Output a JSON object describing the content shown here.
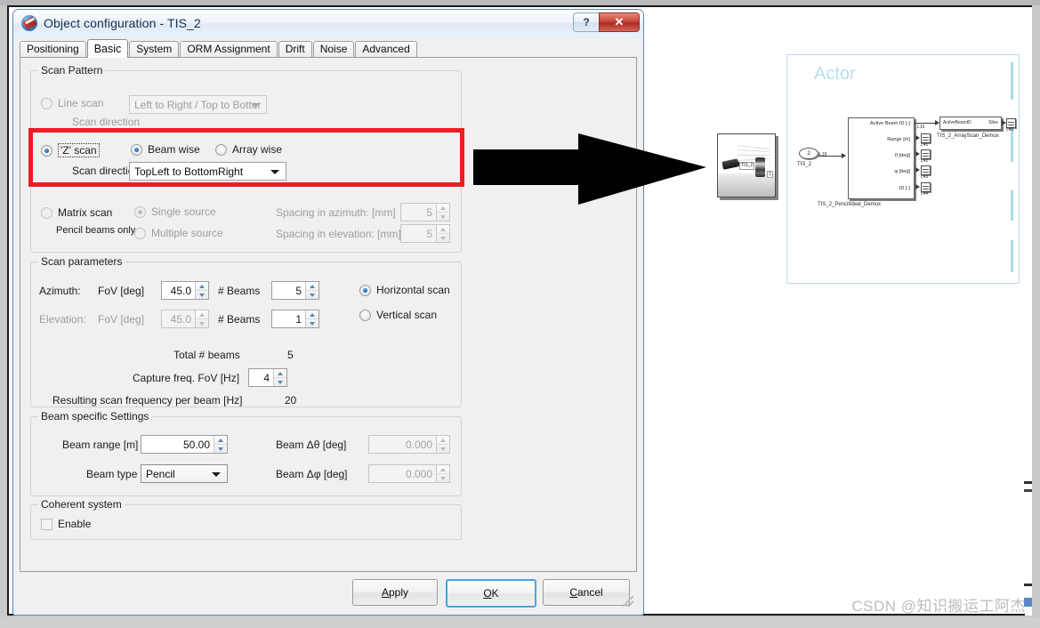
{
  "window": {
    "title": "Object configuration - TIS_2",
    "help_button": "?",
    "close_button": "✕",
    "app_icon": "globe-tool-icon"
  },
  "tabs": [
    {
      "label": "Positioning",
      "active": false
    },
    {
      "label": "Basic",
      "active": true
    },
    {
      "label": "System",
      "active": false
    },
    {
      "label": "ORM Assignment",
      "active": false
    },
    {
      "label": "Drift",
      "active": false
    },
    {
      "label": "Noise",
      "active": false
    },
    {
      "label": "Advanced",
      "active": false
    }
  ],
  "scan_pattern": {
    "legend": "Scan Pattern",
    "line_scan": {
      "label": "Line scan",
      "selected": false,
      "direction_label": "Scan direction",
      "direction_value": "Left to Right / Top to Bottor",
      "direction_enabled": false
    },
    "z_scan": {
      "label": "'Z' scan",
      "selected": true,
      "beam_wise": {
        "label": "Beam wise",
        "selected": true
      },
      "array_wise": {
        "label": "Array wise",
        "selected": false
      },
      "direction_label": "Scan direction",
      "direction_value": "TopLeft to BottomRight",
      "direction_enabled": true,
      "highlight_color": "#ee1c26"
    },
    "matrix_scan": {
      "label": "Matrix scan",
      "sublabel": "Pencil beams only",
      "selected": false,
      "single_source": {
        "label": "Single source",
        "selected": true
      },
      "multiple_source": {
        "label": "Multiple source",
        "selected": false
      },
      "spacing_azimuth_label": "Spacing in azimuth:   [mm]",
      "spacing_azimuth_value": "5",
      "spacing_elevation_label": "Spacing in elevation: [mm]",
      "spacing_elevation_value": "5"
    }
  },
  "scan_parameters": {
    "legend": "Scan parameters",
    "azimuth_label": "Azimuth:",
    "azimuth_fov_label": "FoV [deg]",
    "azimuth_fov_value": "45.0",
    "azimuth_beams_label": "# Beams",
    "azimuth_beams_value": "5",
    "elevation_label": "Elevation:",
    "elevation_fov_label": "FoV [deg]",
    "elevation_fov_value": "45.0",
    "elevation_beams_label": "# Beams",
    "elevation_beams_value": "1",
    "horizontal_scan": {
      "label": "Horizontal scan",
      "selected": true
    },
    "vertical_scan": {
      "label": "Vertical scan",
      "selected": false
    },
    "total_beams_label": "Total # beams",
    "total_beams_value": "5",
    "capture_freq_label": "Capture freq. FoV [Hz]",
    "capture_freq_value": "4",
    "resulting_freq_label": "Resulting scan frequency per beam [Hz]",
    "resulting_freq_value": "20"
  },
  "beam_settings": {
    "legend": "Beam specific Settings",
    "beam_range_label": "Beam range [m]",
    "beam_range_value": "50.00",
    "beam_type_label": "Beam type",
    "beam_type_value": "Pencil",
    "delta_theta_label": "Beam  Δθ [deg]",
    "delta_theta_value": "0.000",
    "delta_phi_label": "Beam  Δφ [deg]",
    "delta_phi_value": "0.000"
  },
  "coherent_system": {
    "legend": "Coherent system",
    "enable_label": "Enable",
    "enabled": false
  },
  "buttons": {
    "apply": "Apply",
    "ok": "OK",
    "cancel": "Cancel"
  },
  "simulink": {
    "panel_title": "Actor",
    "inport": {
      "number": "2",
      "name": "TIS_2",
      "signal": "L19"
    },
    "demux_block": {
      "name": "TIS_2_PencilIdeal_Demux",
      "ports": [
        "Active Beam ID [-]",
        "Range [m]",
        "θ [deg]",
        "φ [deg]",
        "ID [-]"
      ],
      "port_signals": [
        "L15",
        "L41",
        "L42",
        "L43",
        "L44"
      ]
    },
    "slice_block": {
      "name": "TIS_2_ArrayScan_Demux",
      "input_label": "ActiveBeamID",
      "output_label": "Slice",
      "out_signal": "L40"
    },
    "thumbnail": {
      "label": "TIS_2",
      "corner_number": "1"
    }
  },
  "watermark": "CSDN @知识搬运工阿杰"
}
